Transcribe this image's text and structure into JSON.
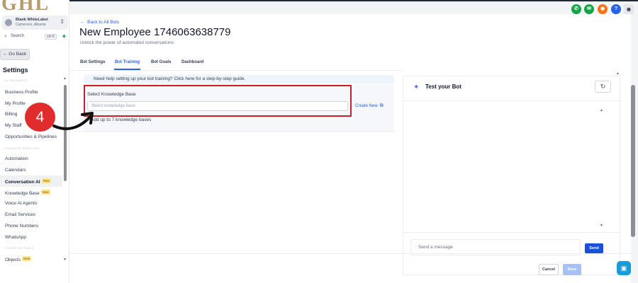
{
  "sidebar": {
    "logo": "GHL",
    "account_name": "Blank WhiteLabel",
    "account_location": "Cameroon, Albania",
    "search_placeholder": "Search",
    "search_shortcut": "ctrl K",
    "go_back": "← Go Back",
    "settings_title": "Settings",
    "sections": [
      "MY BUSINESS",
      "BUSINESS SERVICES",
      "OTHER SETTINGS"
    ],
    "items": [
      {
        "label": "Business Profile"
      },
      {
        "label": "My Profile"
      },
      {
        "label": "Billing"
      },
      {
        "label": "My Staff"
      },
      {
        "label": "Opportunities & Pipelines"
      },
      {
        "label": "Automation"
      },
      {
        "label": "Calendars"
      },
      {
        "label": "Conversation AI",
        "badge": "New"
      },
      {
        "label": "Knowledge Base",
        "badge": "New"
      },
      {
        "label": "Voice AI Agents"
      },
      {
        "label": "Email Services"
      },
      {
        "label": "Phone Numbers"
      },
      {
        "label": "WhatsApp"
      },
      {
        "label": "Objects",
        "badge": "New"
      }
    ]
  },
  "header": {
    "back_link": "Back to All Bots",
    "title": "New Employee 1746063638779",
    "subtitle": "Unlock the power of automated conversations",
    "tabs": [
      "Bot Settings",
      "Bot Training",
      "Bot Goals",
      "Dashboard"
    ],
    "active_tab": "Bot Training"
  },
  "training": {
    "help_text": "Need help setting up your bot training? Click here for a step-by-step guide.",
    "kb_label": "Select Knowledge Base",
    "kb_placeholder": "Select knowledge base",
    "create_new": "Create New",
    "hint": "Add up to 7 knowledge bases"
  },
  "annotation": {
    "step_number": "4"
  },
  "test_panel": {
    "title": "Test your Bot",
    "message_placeholder": "Send a message",
    "send_label": "Send"
  },
  "footer": {
    "cancel_label": "Cancel",
    "save_label": "Save"
  },
  "colors": {
    "accent": "#2563eb",
    "highlight_box": "#cc1f2a",
    "step_circle": "#e02c2c"
  }
}
